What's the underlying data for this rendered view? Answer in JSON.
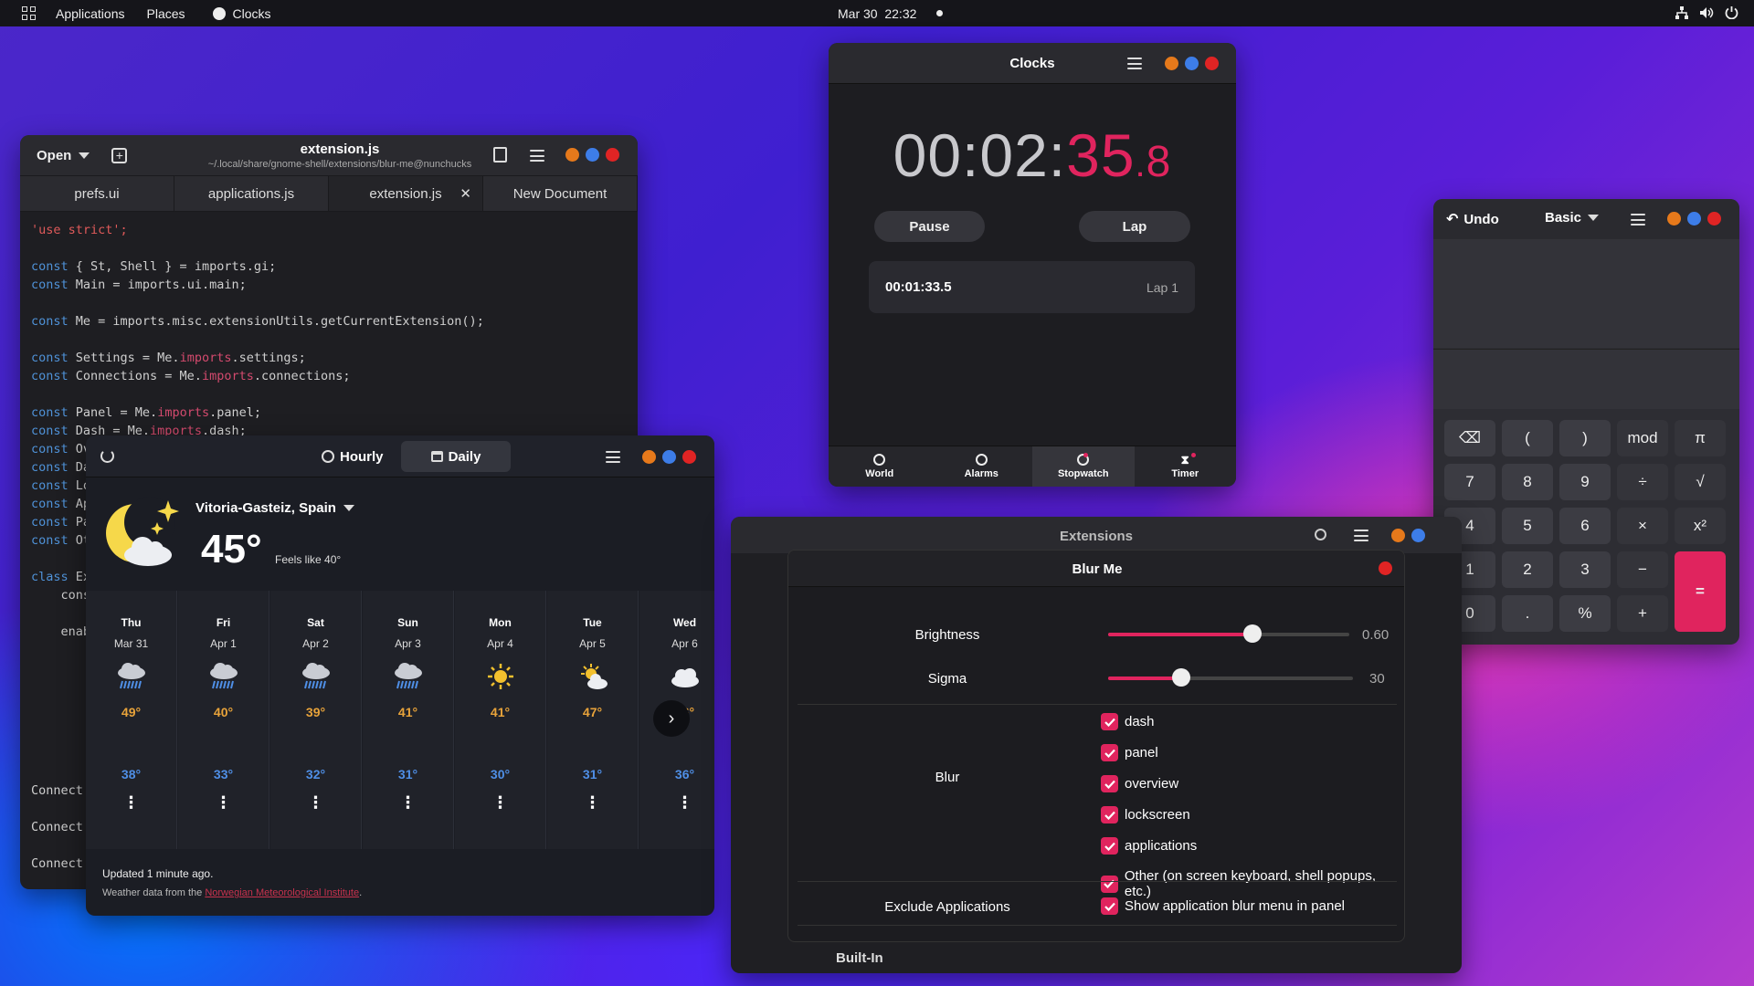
{
  "topbar": {
    "applications": "Applications",
    "places": "Places",
    "app": "Clocks",
    "datetime": "Mar 30  22:32"
  },
  "editor": {
    "open": "Open",
    "title": "extension.js",
    "path": "~/.local/share/gnome-shell/extensions/blur-me@nunchucks",
    "tabs": [
      "prefs.ui",
      "applications.js",
      "extension.js",
      "New Document"
    ],
    "code": [
      "'use strict';",
      "",
      "const { St, Shell } = imports.gi;",
      "const Main = imports.ui.main;",
      "",
      "const Me = imports.misc.extensionUtils.getCurrentExtension();",
      "",
      "const Settings = Me.imports.settings;",
      "const Connections = Me.imports.connections;",
      "",
      "const Panel = Me.imports.panel;",
      "const Dash = Me.imports.dash;",
      "const Ov",
      "const Da",
      "const Lo",
      "const Ap",
      "const Pa",
      "const Ot",
      "",
      "class Ex",
      "    cons",
      "",
      "    enab"
    ],
    "bottom": [
      "Connect",
      "Connect",
      "Connect"
    ]
  },
  "weather": {
    "hourly": "Hourly",
    "daily": "Daily",
    "location": "Vitoria-Gasteiz, Spain",
    "temp": "45°",
    "feels": "Feels like 40°",
    "days": [
      {
        "day": "Thu",
        "date": "Mar 31",
        "hi": "49°",
        "lo": "38°",
        "icon": "rain"
      },
      {
        "day": "Fri",
        "date": "Apr 1",
        "hi": "40°",
        "lo": "33°",
        "icon": "rain"
      },
      {
        "day": "Sat",
        "date": "Apr 2",
        "hi": "39°",
        "lo": "32°",
        "icon": "rain"
      },
      {
        "day": "Sun",
        "date": "Apr 3",
        "hi": "41°",
        "lo": "31°",
        "icon": "rain"
      },
      {
        "day": "Mon",
        "date": "Apr 4",
        "hi": "41°",
        "lo": "30°",
        "icon": "sun"
      },
      {
        "day": "Tue",
        "date": "Apr 5",
        "hi": "47°",
        "lo": "31°",
        "icon": "partly-sunny"
      },
      {
        "day": "Wed",
        "date": "Apr 6",
        "hi": "46°",
        "lo": "36°",
        "icon": "cloudy"
      }
    ],
    "updated": "Updated 1 minute ago.",
    "source_prefix": "Weather data from the ",
    "source_link": "Norwegian Meteorological Institute",
    "source_suffix": "."
  },
  "clocks": {
    "title": "Clocks",
    "time_main": "00:02:",
    "time_sec": "35",
    "time_frac": "8",
    "pause": "Pause",
    "lap": "Lap",
    "lap_time": "00:01:33.5",
    "lap_label": "Lap 1",
    "nav": [
      "World",
      "Alarms",
      "Stopwatch",
      "Timer"
    ]
  },
  "calc": {
    "undo": "Undo",
    "mode": "Basic",
    "keys": [
      [
        "⌫",
        "(",
        ")",
        "mod",
        "π"
      ],
      [
        "7",
        "8",
        "9",
        "÷",
        "√"
      ],
      [
        "4",
        "5",
        "6",
        "×",
        "x²"
      ],
      [
        "1",
        "2",
        "3",
        "−",
        "="
      ],
      [
        "0",
        ".",
        "%",
        "+",
        ""
      ]
    ]
  },
  "ext": {
    "title": "Extensions",
    "dialog": "Blur Me",
    "brightness": "Brightness",
    "brightness_val": "0.60",
    "brightness_level": 0.6,
    "sigma": "Sigma",
    "sigma_val": "30",
    "sigma_level": 0.3,
    "blur": "Blur",
    "options": [
      "dash",
      "panel",
      "overview",
      "lockscreen",
      "applications",
      "Other (on screen keyboard, shell popups, etc.)"
    ],
    "exclude": "Exclude Applications",
    "exclude_opt": "Show application blur menu in panel",
    "builtin": "Built-In"
  },
  "colors": {
    "accent": "#e0245e",
    "orange": "#e6791b",
    "blue": "#3d7de8",
    "red": "#e02424",
    "hi": "#e8a33a",
    "lo": "#4f8fe6"
  }
}
